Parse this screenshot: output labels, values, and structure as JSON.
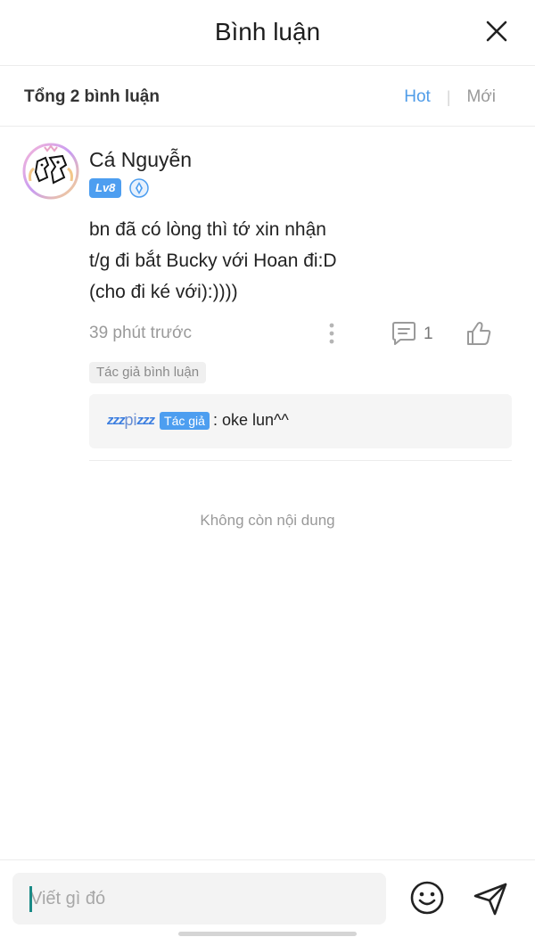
{
  "header": {
    "title": "Bình luận"
  },
  "subbar": {
    "total": "Tổng 2 bình luận",
    "sort_hot": "Hot",
    "sort_new": "Mới"
  },
  "comment": {
    "username": "Cá Nguyễn",
    "level": "Lv8",
    "lines": [
      "bn đã có lòng thì tớ xin nhận",
      "t/g đi bắt Bucky với Hoan đi:D",
      "(cho đi ké với):))))"
    ],
    "time": "39 phút trước",
    "reply_count": "1",
    "author_tag": "Tác giả bình luận",
    "reply": {
      "name_prefix": "zzz",
      "name": "pi",
      "name_suffix": "zzz",
      "tag": "Tác giả",
      "text": ": oke lun^^"
    }
  },
  "footer_note": "Không còn nội dung",
  "input": {
    "placeholder": "Viết gì đó"
  },
  "colors": {
    "accent": "#4d9ef0",
    "hot": "#4f9ce8",
    "caret": "#1a8a86"
  }
}
